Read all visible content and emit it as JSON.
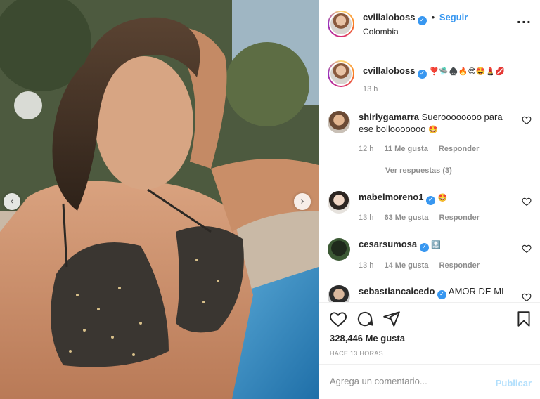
{
  "post": {
    "username": "cvillaloboss",
    "follow_label": "Seguir",
    "location": "Colombia",
    "more_icon": "more-horizontal-icon"
  },
  "caption": {
    "username": "cvillaloboss",
    "emojis": "❣️🛸♠️🔥😎🤩💄💋",
    "time": "13 h"
  },
  "comments": [
    {
      "username": "shirlygamarra",
      "verified": false,
      "text": "Sueroooooooo para ese bollooooooo",
      "emoji": "🤩",
      "time": "12 h",
      "likes": "11 Me gusta",
      "reply": "Responder"
    },
    {
      "username": "mabelmoreno1",
      "verified": true,
      "text": "",
      "emoji": "🤩",
      "time": "13 h",
      "likes": "63 Me gusta",
      "reply": "Responder"
    },
    {
      "username": "cesarsumosa",
      "verified": true,
      "text": "",
      "emoji": "🔝",
      "time": "13 h",
      "likes": "14 Me gusta",
      "reply": "Responder"
    },
    {
      "username": "sebastiancaicedo",
      "verified": true,
      "text": "AMOR DE MI",
      "emoji": "",
      "time": "",
      "likes": "",
      "reply": ""
    }
  ],
  "view_replies": "Ver respuestas (3)",
  "actions": {
    "like_icon": "heart-icon",
    "comment_icon": "comment-icon",
    "share_icon": "send-icon",
    "save_icon": "bookmark-icon"
  },
  "likes_label": "328,446 Me gusta",
  "time_ago": "HACE 13 HORAS",
  "composer": {
    "placeholder": "Agrega un comentario...",
    "publish_label": "Publicar"
  },
  "colors": {
    "accent": "#3897f0",
    "publish_disabled": "#b2dffc",
    "muted": "#8e8e8e"
  }
}
